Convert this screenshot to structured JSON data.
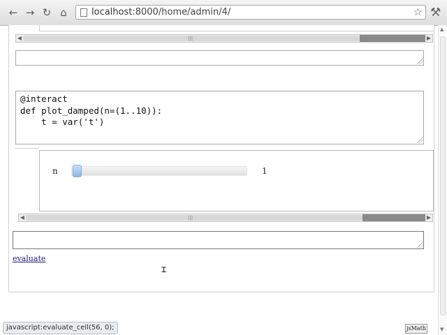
{
  "browser": {
    "url_host": "localhost",
    "url_path": ":8000/home/admin/4/",
    "icons": {
      "back": "back-arrow-icon",
      "forward": "forward-arrow-icon",
      "reload": "reload-icon",
      "home": "home-icon",
      "bookmark": "star-icon",
      "menu": "wrench-icon"
    }
  },
  "cells": {
    "code_lines": [
      "@interact",
      "def plot_damped(n=(1..10)):",
      "    t = var('t')"
    ]
  },
  "interact": {
    "variable_label": "n",
    "slider_value": "1",
    "slider_position_fraction": 0.0
  },
  "actions": {
    "evaluate_label": "evaluate"
  },
  "status": {
    "link_text": "javascript:evaluate_cell(56, 0);",
    "jsmath_label": "jsMath"
  },
  "colors": {
    "link": "#1a1a8c",
    "slider_handle": "#8fb6e6",
    "border": "#a8a8a8"
  }
}
